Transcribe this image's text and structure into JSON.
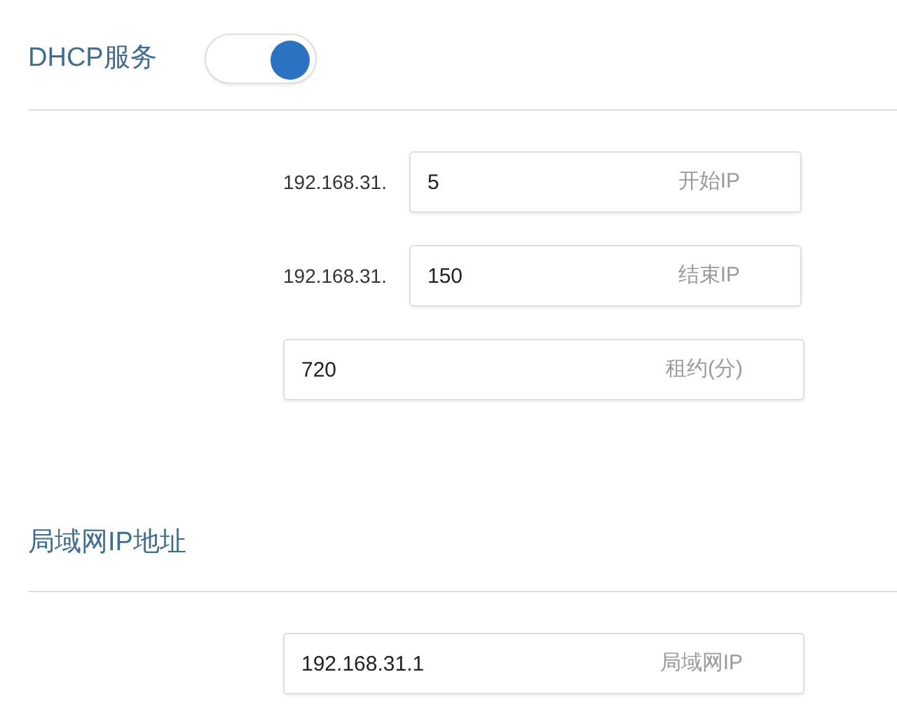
{
  "sections": [
    {
      "title": "DHCP服务",
      "toggle": {
        "on": true
      },
      "fields": [
        {
          "prefix": "192.168.31.",
          "value": "5",
          "suffix": "开始IP"
        },
        {
          "prefix": "192.168.31.",
          "value": "150",
          "suffix": "结束IP"
        },
        {
          "value": "720",
          "suffix": "租约(分)"
        }
      ]
    },
    {
      "title": "局域网IP地址",
      "fields": [
        {
          "value": "192.168.31.1",
          "suffix": "局域网IP"
        }
      ]
    }
  ]
}
